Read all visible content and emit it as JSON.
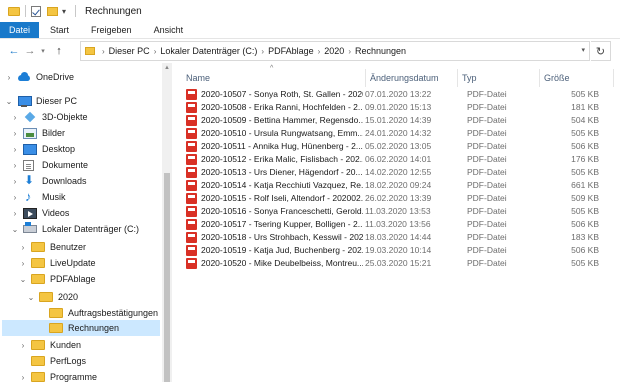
{
  "window": {
    "title": "Rechnungen",
    "quick_access_arrow": "▾"
  },
  "ribbon": {
    "tabs": [
      "Datei",
      "Start",
      "Freigeben",
      "Ansicht"
    ]
  },
  "address": {
    "crumbs": [
      "Dieser PC",
      "Lokaler Datenträger (C:)",
      "PDFAblage",
      "2020",
      "Rechnungen"
    ],
    "separator": "›"
  },
  "navigation": {
    "items": [
      {
        "label": "OneDrive",
        "icon": "onedrive-icon",
        "chevron": "›",
        "selected": false
      },
      {
        "label": "Dieser PC",
        "icon": "computer-icon",
        "chevron": "⌄",
        "selected": false
      },
      {
        "label": "3D-Objekte",
        "icon": "3d-objects-icon",
        "chevron": "›",
        "selected": false
      },
      {
        "label": "Bilder",
        "icon": "pictures-icon",
        "chevron": "›",
        "selected": false
      },
      {
        "label": "Desktop",
        "icon": "desktop-icon",
        "chevron": "›",
        "selected": false
      },
      {
        "label": "Dokumente",
        "icon": "documents-icon",
        "chevron": "›",
        "selected": false
      },
      {
        "label": "Downloads",
        "icon": "downloads-icon",
        "chevron": "›",
        "selected": false
      },
      {
        "label": "Musik",
        "icon": "music-icon",
        "chevron": "›",
        "selected": false
      },
      {
        "label": "Videos",
        "icon": "videos-icon",
        "chevron": "›",
        "selected": false
      },
      {
        "label": "Lokaler Datenträger (C:)",
        "icon": "drive-icon",
        "chevron": "⌄",
        "selected": false
      },
      {
        "label": "Benutzer",
        "icon": "folder-icon",
        "chevron": "›",
        "selected": false
      },
      {
        "label": "LiveUpdate",
        "icon": "folder-icon",
        "chevron": "›",
        "selected": false
      },
      {
        "label": "PDFAblage",
        "icon": "folder-icon",
        "chevron": "⌄",
        "selected": false
      },
      {
        "label": "2020",
        "icon": "folder-icon",
        "chevron": "⌄",
        "selected": false
      },
      {
        "label": "Auftragsbestätigungen",
        "icon": "folder-icon",
        "chevron": "",
        "selected": false
      },
      {
        "label": "Rechnungen",
        "icon": "folder-icon",
        "chevron": "",
        "selected": true
      },
      {
        "label": "Kunden",
        "icon": "folder-icon",
        "chevron": "›",
        "selected": false
      },
      {
        "label": "PerfLogs",
        "icon": "folder-icon",
        "chevron": "",
        "selected": false
      },
      {
        "label": "Programme",
        "icon": "folder-icon",
        "chevron": "›",
        "selected": false
      }
    ]
  },
  "columns": {
    "name": "Name",
    "date": "Änderungsdatum",
    "type": "Typ",
    "size": "Größe",
    "sort_indicator": "^"
  },
  "files": [
    {
      "name": "2020-10507 - Sonya Roth, St. Gallen - 2020...",
      "date": "07.01.2020 13:22",
      "type": "PDF-Datei",
      "size": "505 KB"
    },
    {
      "name": "2020-10508 - Erika  Ranni, Hochfelden - 2...",
      "date": "09.01.2020 15:13",
      "type": "PDF-Datei",
      "size": "181 KB"
    },
    {
      "name": "2020-10509 - Bettina Hammer, Regensdo...",
      "date": "15.01.2020 14:39",
      "type": "PDF-Datei",
      "size": "504 KB"
    },
    {
      "name": "2020-10510 - Ursula Rungwatsang, Emm...",
      "date": "24.01.2020 14:32",
      "type": "PDF-Datei",
      "size": "505 KB"
    },
    {
      "name": "2020-10511 - Annika Hug, Hünenberg - 2...",
      "date": "05.02.2020 13:05",
      "type": "PDF-Datei",
      "size": "506 KB"
    },
    {
      "name": "2020-10512 - Erika  Malic, Fislisbach - 202...",
      "date": "06.02.2020 14:01",
      "type": "PDF-Datei",
      "size": "176 KB"
    },
    {
      "name": "2020-10513 - Urs Diener, Hägendorf - 20...",
      "date": "14.02.2020 12:55",
      "type": "PDF-Datei",
      "size": "505 KB"
    },
    {
      "name": "2020-10514 - Katja Recchiuti Vazquez, Re...",
      "date": "18.02.2020 09:24",
      "type": "PDF-Datei",
      "size": "661 KB"
    },
    {
      "name": "2020-10515 - Rolf Iseli, Altendorf - 202002...",
      "date": "26.02.2020 13:39",
      "type": "PDF-Datei",
      "size": "509 KB"
    },
    {
      "name": "2020-10516 - Sonya Franceschetti, Gerold...",
      "date": "11.03.2020 13:53",
      "type": "PDF-Datei",
      "size": "505 KB"
    },
    {
      "name": "2020-10517 - Tsering Kupper, Bolligen - 2...",
      "date": "11.03.2020 13:56",
      "type": "PDF-Datei",
      "size": "506 KB"
    },
    {
      "name": "2020-10518 - Urs Strohbach, Kesswil - 202...",
      "date": "18.03.2020 14:44",
      "type": "PDF-Datei",
      "size": "183 KB"
    },
    {
      "name": "2020-10519 - Katja Jud, Buchenberg - 202...",
      "date": "19.03.2020 10:14",
      "type": "PDF-Datei",
      "size": "506 KB"
    },
    {
      "name": "2020-10520 - Mike Deubelbeiss, Montreu...",
      "date": "25.03.2020 15:21",
      "type": "PDF-Datei",
      "size": "505 KB"
    }
  ]
}
